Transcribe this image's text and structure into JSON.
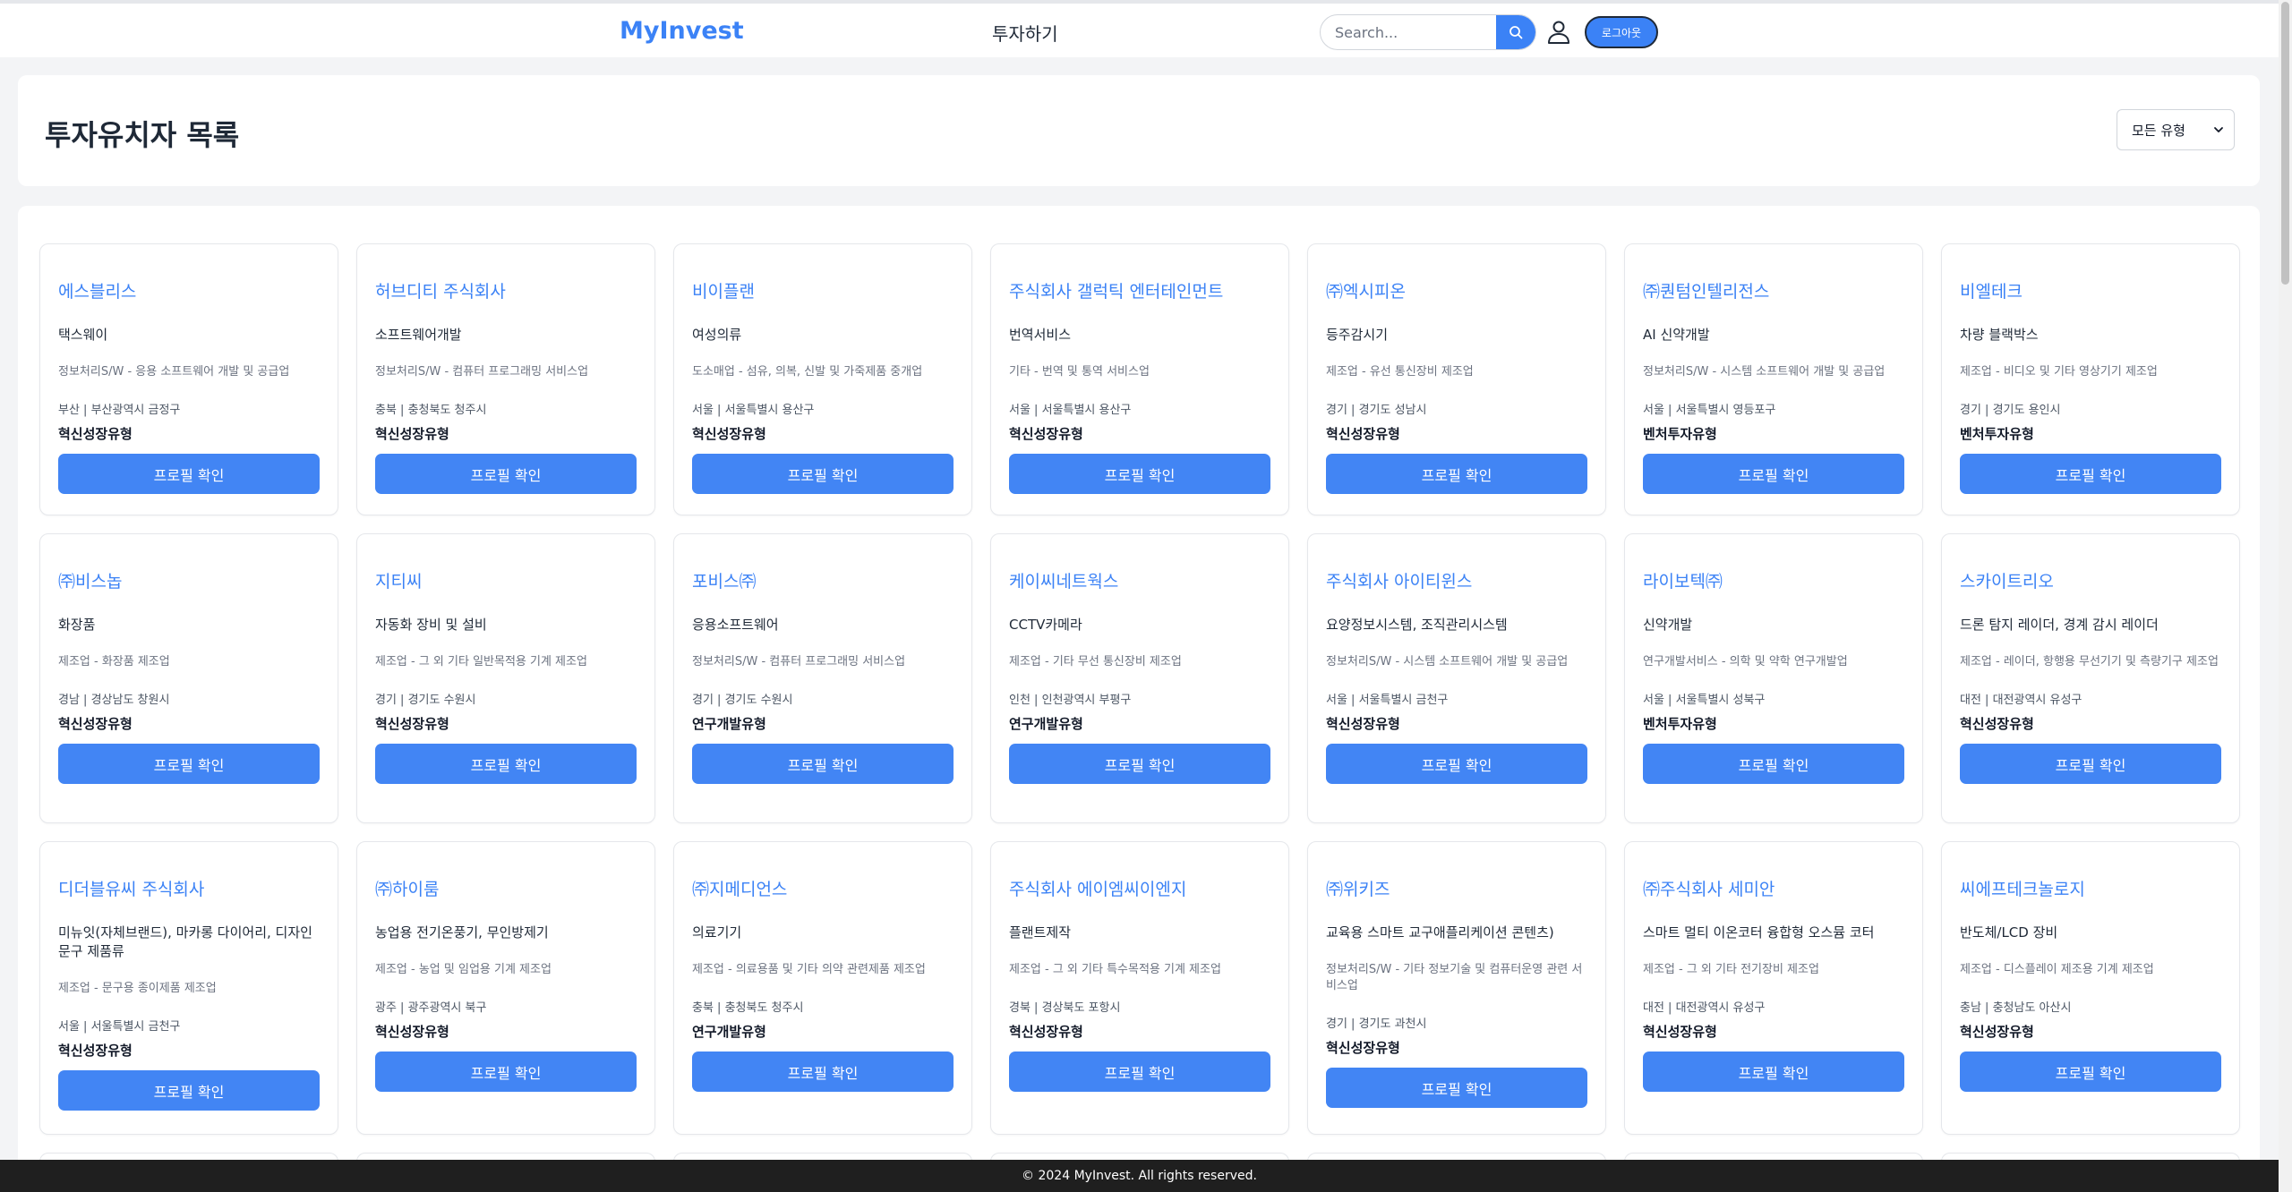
{
  "header": {
    "brand": "MyInvest",
    "nav_invest": "투자하기",
    "search_placeholder": "Search...",
    "logout_label": "로그아웃"
  },
  "page": {
    "title": "투자유치자 목록",
    "filter_selected": "모든 유형"
  },
  "cards": [
    {
      "name": "에스블리스",
      "product": "택스웨이",
      "industry": "정보처리S/W - 응용 소프트웨어 개발 및 공급업",
      "region": "부산 | 부산광역시 금정구",
      "type": "혁신성장유형",
      "button": "프로필 확인"
    },
    {
      "name": "허브디티 주식회사",
      "product": "소프트웨어개발",
      "industry": "정보처리S/W - 컴퓨터 프로그래밍 서비스업",
      "region": "충북 | 충청북도 청주시",
      "type": "혁신성장유형",
      "button": "프로필 확인"
    },
    {
      "name": "비이플랜",
      "product": "여성의류",
      "industry": "도소매업 - 섬유, 의복, 신발 및 가죽제품 중개업",
      "region": "서울 | 서울특별시 용산구",
      "type": "혁신성장유형",
      "button": "프로필 확인"
    },
    {
      "name": "주식회사 갤럭틱 엔터테인먼트",
      "product": "번역서비스",
      "industry": "기타 - 번역 및 통역 서비스업",
      "region": "서울 | 서울특별시 용산구",
      "type": "혁신성장유형",
      "button": "프로필 확인"
    },
    {
      "name": "㈜엑시피온",
      "product": "등주감시기",
      "industry": "제조업 - 유선 통신장비 제조업",
      "region": "경기 | 경기도 성남시",
      "type": "혁신성장유형",
      "button": "프로필 확인"
    },
    {
      "name": "㈜퀀텀인텔리전스",
      "product": "AI 신약개발",
      "industry": "정보처리S/W - 시스템 소프트웨어 개발 및 공급업",
      "region": "서울 | 서울특별시 영등포구",
      "type": "벤처투자유형",
      "button": "프로필 확인"
    },
    {
      "name": "비엘테크",
      "product": "차량 블랙박스",
      "industry": "제조업 - 비디오 및 기타 영상기기 제조업",
      "region": "경기 | 경기도 용인시",
      "type": "벤처투자유형",
      "button": "프로필 확인"
    },
    {
      "name": "㈜비스놉",
      "product": "화장품",
      "industry": "제조업 - 화장품 제조업",
      "region": "경남 | 경상남도 창원시",
      "type": "혁신성장유형",
      "button": "프로필 확인"
    },
    {
      "name": "지티씨",
      "product": "자동화 장비 및 설비",
      "industry": "제조업 - 그 외 기타 일반목적용 기계 제조업",
      "region": "경기 | 경기도 수원시",
      "type": "혁신성장유형",
      "button": "프로필 확인"
    },
    {
      "name": "포비스㈜",
      "product": "응용소프트웨어",
      "industry": "정보처리S/W - 컴퓨터 프로그래밍 서비스업",
      "region": "경기 | 경기도 수원시",
      "type": "연구개발유형",
      "button": "프로필 확인"
    },
    {
      "name": "케이씨네트웍스",
      "product": "CCTV카메라",
      "industry": "제조업 - 기타 무선 통신장비 제조업",
      "region": "인천 | 인천광역시 부평구",
      "type": "연구개발유형",
      "button": "프로필 확인"
    },
    {
      "name": "주식회사 아이티윈스",
      "product": "요양정보시스템, 조직관리시스템",
      "industry": "정보처리S/W - 시스템 소프트웨어 개발 및 공급업",
      "region": "서울 | 서울특별시 금천구",
      "type": "혁신성장유형",
      "button": "프로필 확인"
    },
    {
      "name": "라이보텍㈜",
      "product": "신약개발",
      "industry": "연구개발서비스 - 의학 및 약학 연구개발업",
      "region": "서울 | 서울특별시 성북구",
      "type": "벤처투자유형",
      "button": "프로필 확인"
    },
    {
      "name": "스카이트리오",
      "product": "드론 탐지 레이더, 경계 감시 레이더",
      "industry": "제조업 - 레이더, 항행용 무선기기 및 측량기구 제조업",
      "region": "대전 | 대전광역시 유성구",
      "type": "혁신성장유형",
      "button": "프로필 확인"
    },
    {
      "name": "디더블유씨 주식회사",
      "product": "미뉴잇(자체브랜드), 마카롱 다이어리, 디자인 문구 제품류",
      "industry": "제조업 - 문구용 종이제품 제조업",
      "region": "서울 | 서울특별시 금천구",
      "type": "혁신성장유형",
      "button": "프로필 확인"
    },
    {
      "name": "㈜하이룸",
      "product": "농업용 전기온풍기, 무인방제기",
      "industry": "제조업 - 농업 및 임업용 기계 제조업",
      "region": "광주 | 광주광역시 북구",
      "type": "혁신성장유형",
      "button": "프로필 확인"
    },
    {
      "name": "㈜지메디언스",
      "product": "의료기기",
      "industry": "제조업 - 의료용품 및 기타 의약 관련제품 제조업",
      "region": "충북 | 충청북도 청주시",
      "type": "연구개발유형",
      "button": "프로필 확인"
    },
    {
      "name": "주식회사 에이엠씨이엔지",
      "product": "플랜트제작",
      "industry": "제조업 - 그 외 기타 특수목적용 기계 제조업",
      "region": "경북 | 경상북도 포항시",
      "type": "혁신성장유형",
      "button": "프로필 확인"
    },
    {
      "name": "㈜위키즈",
      "product": "교육용 스마트 교구애플리케이션 콘텐츠)",
      "industry": "정보처리S/W - 기타 정보기술 및 컴퓨터운영 관련 서비스업",
      "region": "경기 | 경기도 과천시",
      "type": "혁신성장유형",
      "button": "프로필 확인"
    },
    {
      "name": "㈜주식회사 세미안",
      "product": "스마트 멀티 이온코터 융합형 오스뮴 코터",
      "industry": "제조업 - 그 외 기타 전기장비 제조업",
      "region": "대전 | 대전광역시 유성구",
      "type": "혁신성장유형",
      "button": "프로필 확인"
    },
    {
      "name": "씨에프테크놀로지",
      "product": "반도체/LCD 장비",
      "industry": "제조업 - 디스플레이 제조용 기계 제조업",
      "region": "충남 | 충청남도 아산시",
      "type": "혁신성장유형",
      "button": "프로필 확인"
    }
  ],
  "footer": {
    "text": "© 2024 MyInvest. All rights reserved."
  }
}
